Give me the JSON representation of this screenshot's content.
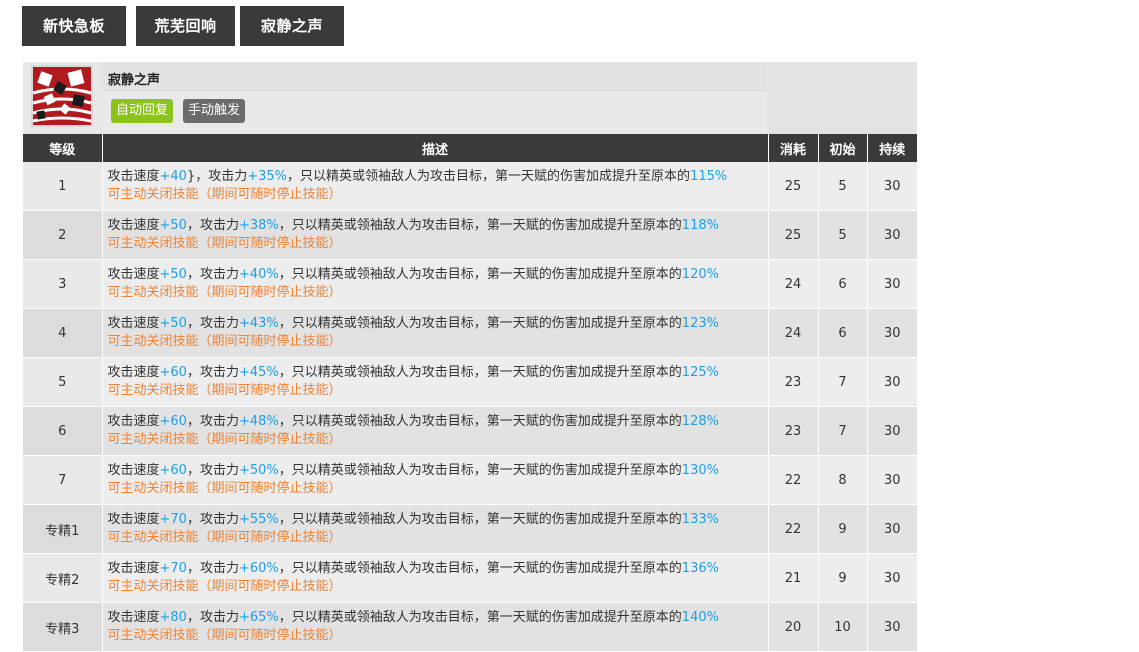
{
  "tabs": [
    "新快急板",
    "荒芜回响",
    "寂静之声"
  ],
  "skill": {
    "name": "寂静之声",
    "icon": "skill-art-icon",
    "tags": [
      {
        "label": "自动回复",
        "color": "#8cc21c"
      },
      {
        "label": "手动触发",
        "color": "#6b6b6b"
      }
    ]
  },
  "table": {
    "headers": [
      "等级",
      "描述",
      "消耗",
      "初始",
      "持续"
    ],
    "rows": [
      {
        "level": "1",
        "spd": "+40",
        "sep": "}，",
        "atk": "+35%",
        "mid": "，只以精英或领袖敌人为攻击目标，第一天赋的伤害加成提升至原本的",
        "pct": "115%",
        "note": "可主动关闭技能（期间可随时停止技能）",
        "cost": "25",
        "init": "5",
        "dur": "30"
      },
      {
        "level": "2",
        "spd": "+50",
        "sep": "，",
        "atk": "+38%",
        "mid": "，只以精英或领袖敌人为攻击目标，第一天赋的伤害加成提升至原本的",
        "pct": "118%",
        "note": "可主动关闭技能（期间可随时停止技能）",
        "cost": "25",
        "init": "5",
        "dur": "30"
      },
      {
        "level": "3",
        "spd": "+50",
        "sep": "，",
        "atk": "+40%",
        "mid": "，只以精英或领袖敌人为攻击目标，第一天赋的伤害加成提升至原本的",
        "pct": "120%",
        "note": "可主动关闭技能（期间可随时停止技能）",
        "cost": "24",
        "init": "6",
        "dur": "30"
      },
      {
        "level": "4",
        "spd": "+50",
        "sep": "，",
        "atk": "+43%",
        "mid": "，只以精英或领袖敌人为攻击目标，第一天赋的伤害加成提升至原本的",
        "pct": "123%",
        "note": "可主动关闭技能（期间可随时停止技能）",
        "cost": "24",
        "init": "6",
        "dur": "30"
      },
      {
        "level": "5",
        "spd": "+60",
        "sep": "，",
        "atk": "+45%",
        "mid": "，只以精英或领袖敌人为攻击目标，第一天赋的伤害加成提升至原本的",
        "pct": "125%",
        "note": "可主动关闭技能（期间可随时停止技能）",
        "cost": "23",
        "init": "7",
        "dur": "30"
      },
      {
        "level": "6",
        "spd": "+60",
        "sep": "，",
        "atk": "+48%",
        "mid": "，只以精英或领袖敌人为攻击目标，第一天赋的伤害加成提升至原本的",
        "pct": "128%",
        "note": "可主动关闭技能（期间可随时停止技能）",
        "cost": "23",
        "init": "7",
        "dur": "30"
      },
      {
        "level": "7",
        "spd": "+60",
        "sep": "，",
        "atk": "+50%",
        "mid": "，只以精英或领袖敌人为攻击目标，第一天赋的伤害加成提升至原本的",
        "pct": "130%",
        "note": "可主动关闭技能（期间可随时停止技能）",
        "cost": "22",
        "init": "8",
        "dur": "30"
      },
      {
        "level": "专精1",
        "spd": "+70",
        "sep": "，",
        "atk": "+55%",
        "mid": "，只以精英或领袖敌人为攻击目标，第一天赋的伤害加成提升至原本的",
        "pct": "133%",
        "note": "可主动关闭技能（期间可随时停止技能）",
        "cost": "22",
        "init": "9",
        "dur": "30"
      },
      {
        "level": "专精2",
        "spd": "+70",
        "sep": "，",
        "atk": "+60%",
        "mid": "，只以精英或领袖敌人为攻击目标，第一天赋的伤害加成提升至原本的",
        "pct": "136%",
        "note": "可主动关闭技能（期间可随时停止技能）",
        "cost": "21",
        "init": "9",
        "dur": "30"
      },
      {
        "level": "专精3",
        "spd": "+80",
        "sep": "，",
        "atk": "+65%",
        "mid": "，只以精英或领袖敌人为攻击目标，第一天赋的伤害加成提升至原本的",
        "pct": "140%",
        "note": "可主动关闭技能（期间可随时停止技能）",
        "cost": "20",
        "init": "10",
        "dur": "30"
      }
    ],
    "text_spd_label": "攻击速度",
    "text_atk_label": "攻击力"
  }
}
